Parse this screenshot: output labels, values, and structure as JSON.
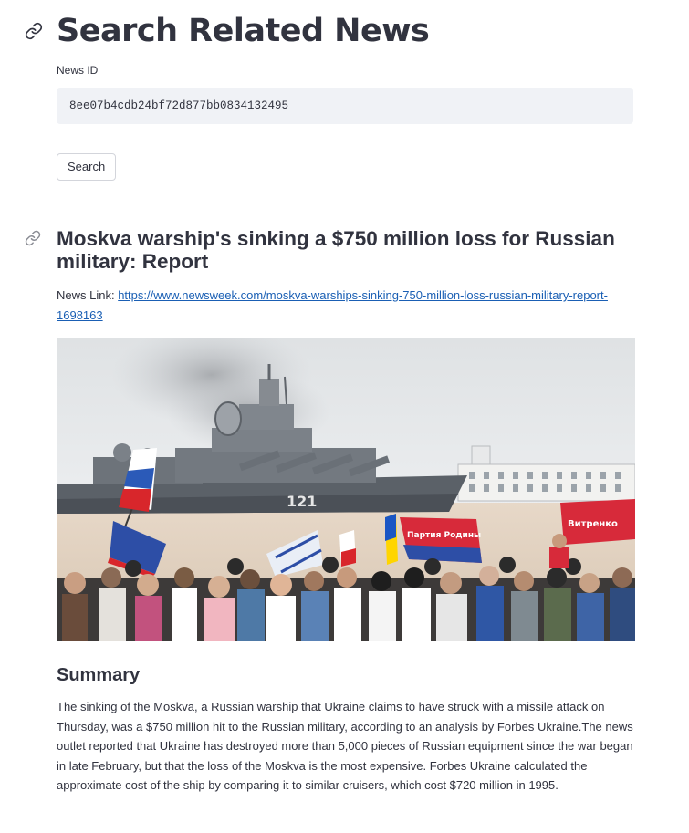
{
  "search_form": {
    "title": "Search Related News",
    "field_label": "News ID",
    "news_id_value": "8ee07b4cdb24bf72d877bb0834132495",
    "search_button_label": "Search"
  },
  "article": {
    "title": "Moskva warship's sinking a $750 million loss for Russian military: Report",
    "link_label": "News Link: ",
    "link_url": "https://www.newsweek.com/moskva-warships-sinking-750-million-loss-russian-military-report-1698163",
    "image_name": "photo of warship Moskva with crowd waving flags",
    "hull_number": "121",
    "banner_text_left": "Партия Родины",
    "banner_text_right": "Витренко",
    "summary_heading": "Summary",
    "summary_text": "The sinking of the Moskva, a Russian warship that Ukraine claims to have struck with a missile attack on Thursday, was a $750 million hit to the Russian military, according to an analysis by Forbes Ukraine.The news outlet reported that Ukraine has destroyed more than 5,000 pieces of Russian equipment since the war began in late February, but that the loss of the Moskva is the most expensive. Forbes Ukraine calculated the approximate cost of the ship by comparing it to similar cruisers, which cost $720 million in 1995."
  },
  "icons": {
    "anchor": "link-icon"
  },
  "colors": {
    "text": "#31333f",
    "input_bg": "#f0f2f6",
    "link": "#1a5fb4"
  }
}
